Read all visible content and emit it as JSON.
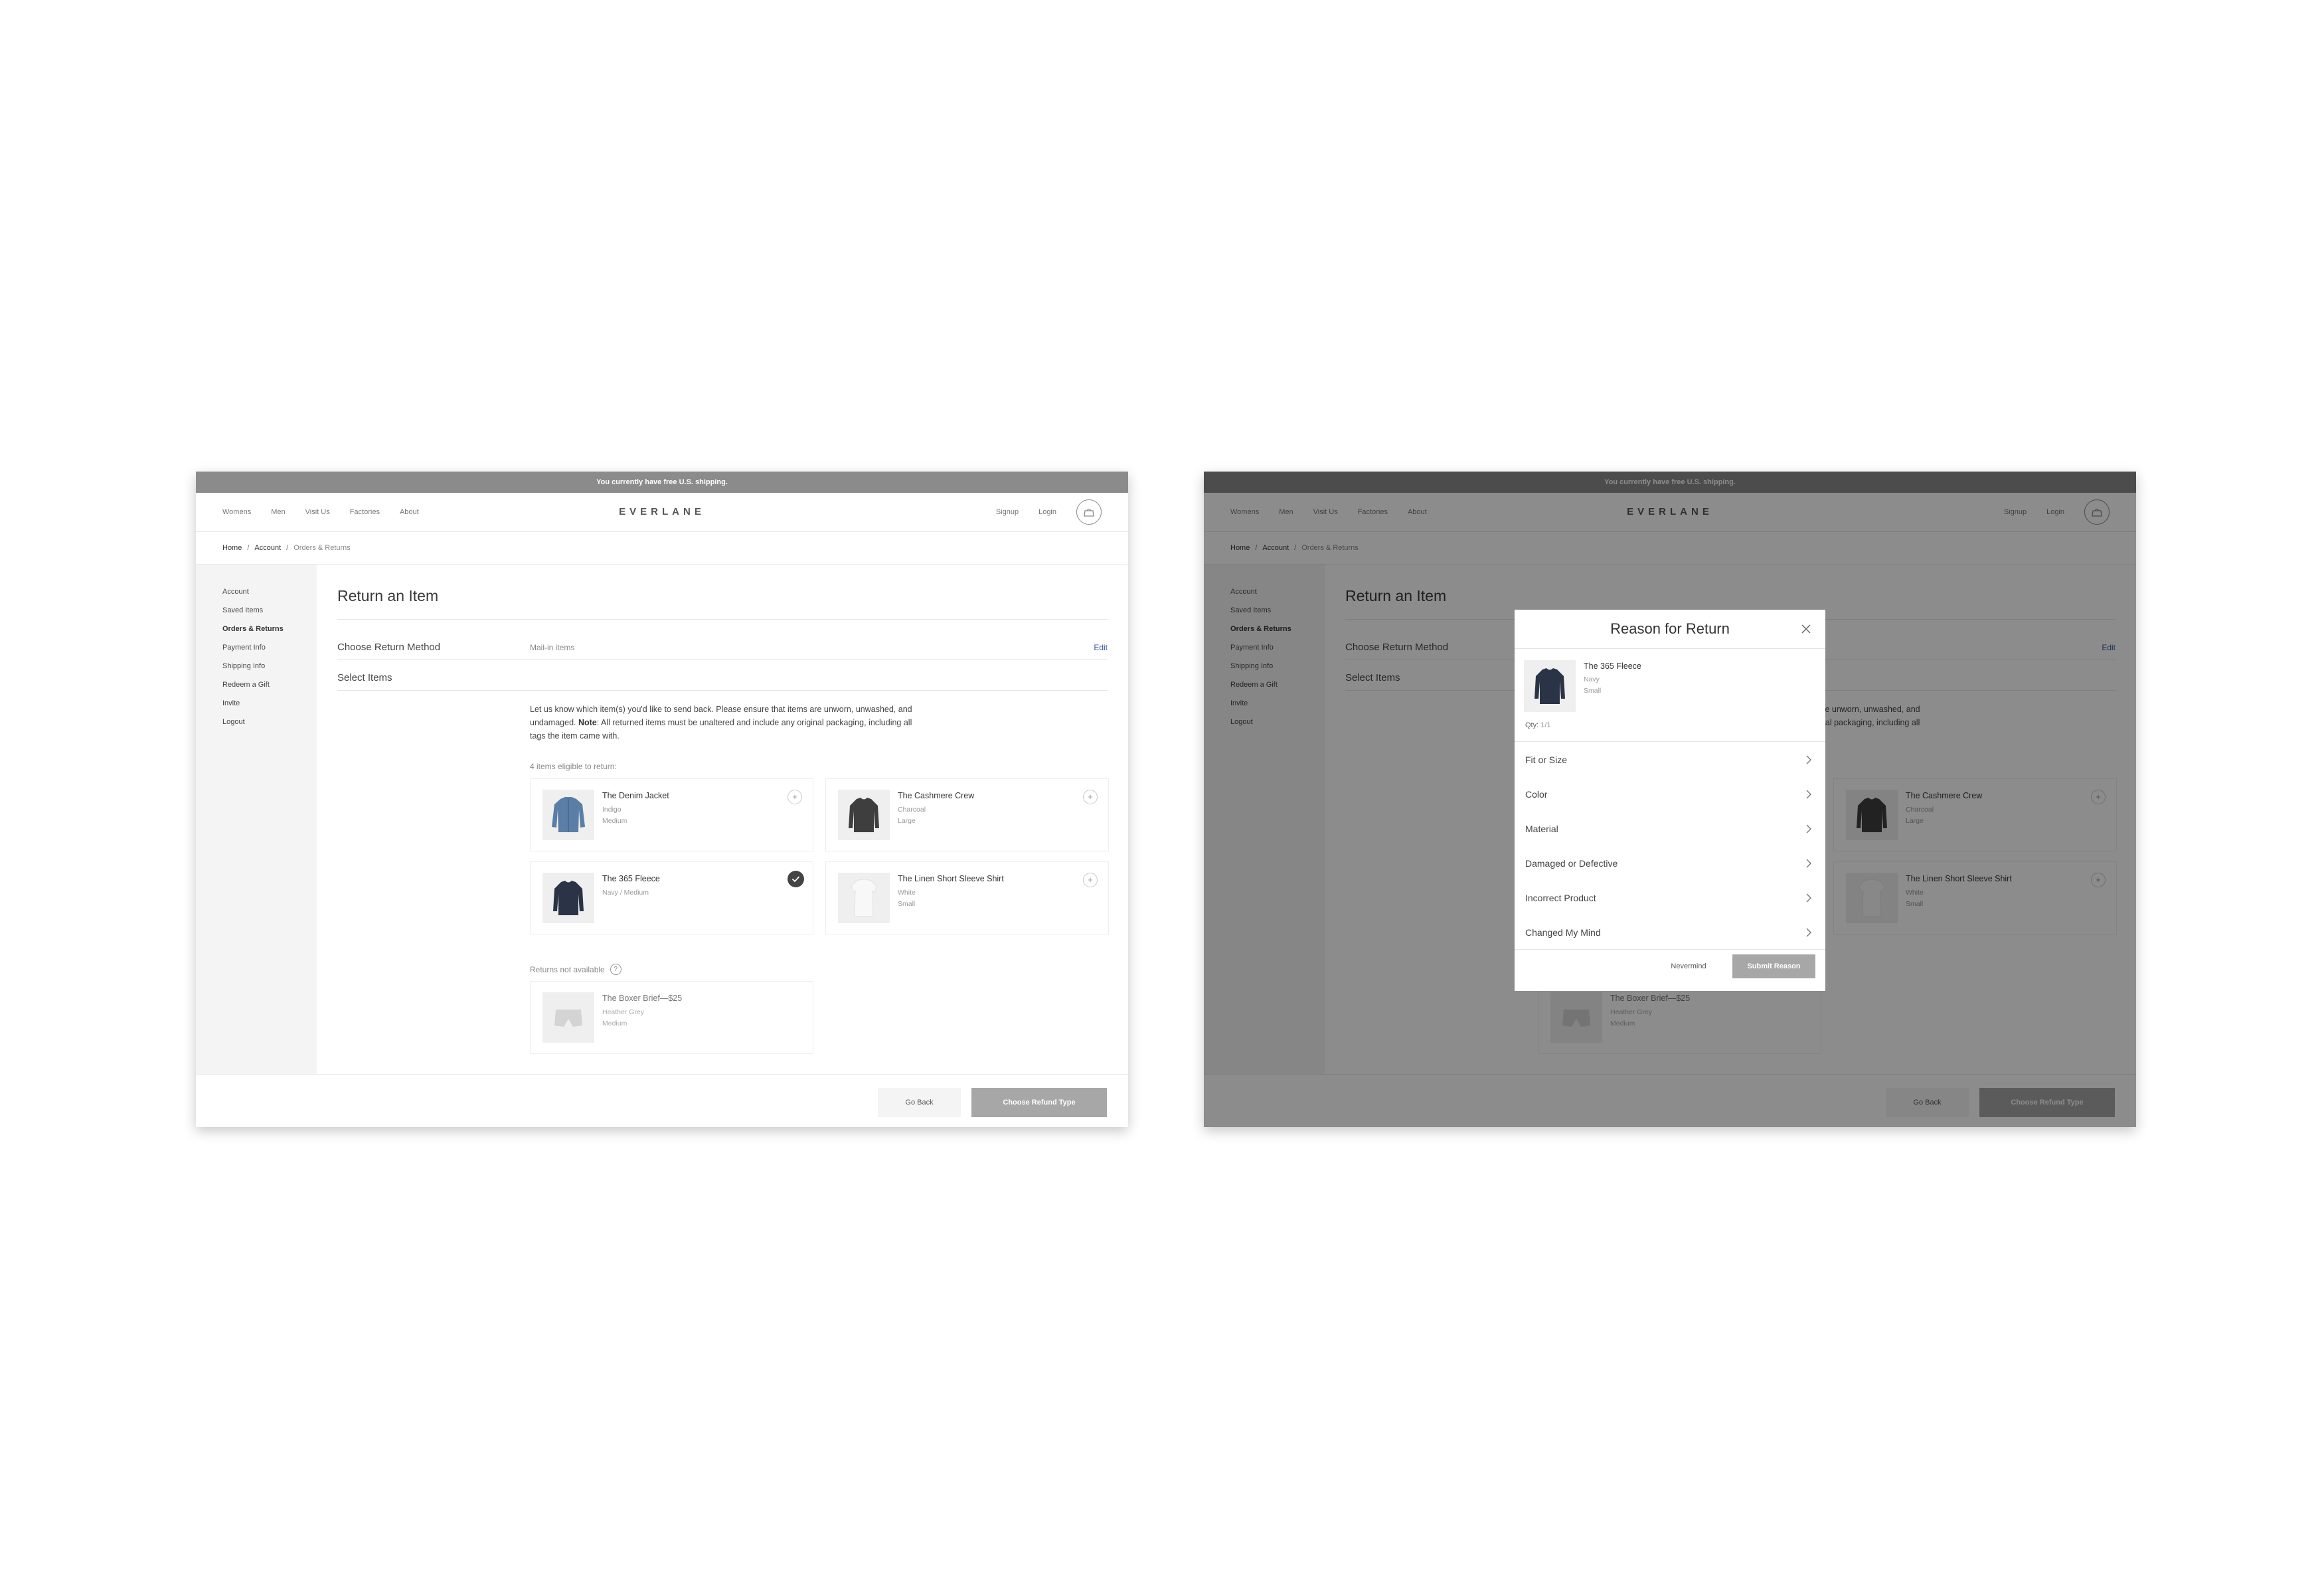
{
  "banner": "You currently have free U.S. shipping.",
  "nav": {
    "left": [
      "Womens",
      "Men",
      "Visit Us",
      "Factories",
      "About"
    ],
    "brand": "EVERLANE",
    "right": [
      "Signup",
      "Login"
    ],
    "cart_icon": "cart-bag-icon"
  },
  "breadcrumb": {
    "home": "Home",
    "account": "Account",
    "current": "Orders & Returns",
    "sep": "/"
  },
  "sidebar": {
    "items": [
      "Account",
      "Saved Items",
      "Orders & Returns",
      "Payment Info",
      "Shipping Info",
      "Redeem a Gift",
      "Invite",
      "Logout"
    ],
    "active": "Orders & Returns"
  },
  "main": {
    "title": "Return an Item",
    "method_label": "Choose Return Method",
    "method_value": "Mail-in items",
    "edit": "Edit",
    "select_label": "Select Items",
    "intro_before": "Let us know which item(s) you'd like to send back. Please ensure that items are unworn, unwashed, and undamaged. ",
    "intro_note": "Note",
    "intro_after": ": All returned items must be unaltered and include any original packaging, including all tags the item came with.",
    "eligible_label": "4 items eligible to return:",
    "eligible": [
      {
        "name": "The Denim Jacket",
        "variant1": "Indigo",
        "variant2": "Medium",
        "selected": false
      },
      {
        "name": "The Cashmere Crew",
        "variant1": "Charcoal",
        "variant2": "Large",
        "selected": false
      },
      {
        "name": "The 365 Fleece",
        "variant1": "Navy / Medium",
        "variant2": "",
        "selected": true
      },
      {
        "name": "The Linen Short Sleeve Shirt",
        "variant1": "White",
        "variant2": "Small",
        "selected": false
      }
    ],
    "add_symbol": "+",
    "na_label": "Returns not available",
    "help_symbol": "?",
    "unavailable": [
      {
        "name": "The Boxer Brief—$25",
        "variant1": "Heather Grey",
        "variant2": "Medium"
      }
    ]
  },
  "footer": {
    "back": "Go Back",
    "refund": "Choose Refund Type"
  },
  "modal": {
    "title": "Reason for Return",
    "item_name": "The 365 Fleece",
    "item_variant1": "Navy",
    "item_variant2": "Small",
    "qty_label": "Qty:",
    "qty_value": "1/1",
    "reasons": [
      "Fit or Size",
      "Color",
      "Material",
      "Damaged or Defective",
      "Incorrect Product",
      "Changed My Mind"
    ],
    "nevermind": "Nevermind",
    "submit": "Submit Reason"
  },
  "colors": {
    "banner": "#8b8b8b",
    "link": "#3b5998",
    "primary_button_disabled": "#a7a7a7",
    "overlay": "rgba(0,0,0,0.45)"
  }
}
